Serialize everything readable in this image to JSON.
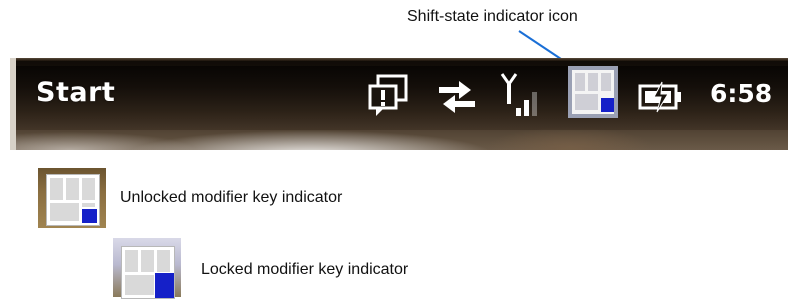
{
  "callout": {
    "label": "Shift-state indicator icon"
  },
  "taskbar": {
    "start_label": "Start",
    "clock": "6:58",
    "tray_icons": [
      "notification-icon",
      "sync-arrows-icon",
      "signal-strength-icon",
      "shift-state-icon",
      "battery-charging-icon"
    ]
  },
  "legend": {
    "unlocked_label": "Unlocked modifier key indicator",
    "locked_label": "Locked modifier key indicator"
  },
  "colors": {
    "indicator_blue": "#1520c8",
    "callout_line": "#1a6fd6"
  }
}
